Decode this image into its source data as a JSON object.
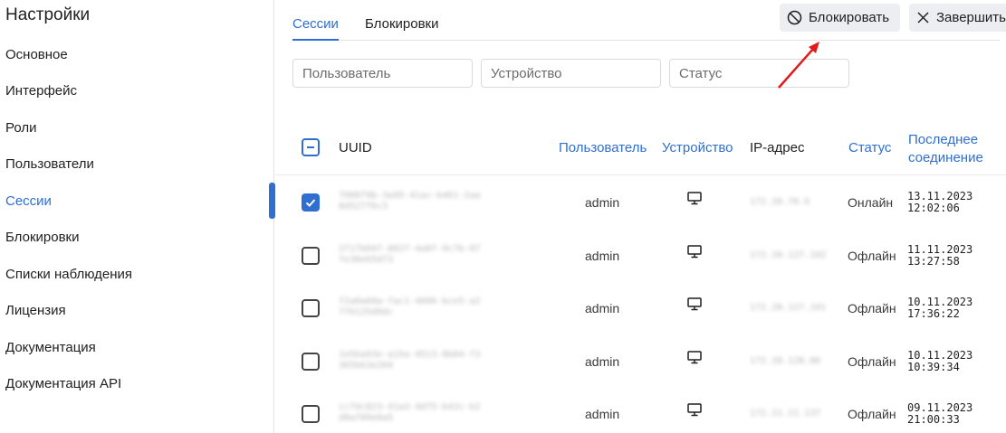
{
  "sidebar": {
    "title": "Настройки",
    "items": [
      {
        "label": "Основное"
      },
      {
        "label": "Интерфейс"
      },
      {
        "label": "Роли"
      },
      {
        "label": "Пользователи"
      },
      {
        "label": "Сессии"
      },
      {
        "label": "Блокировки"
      },
      {
        "label": "Списки наблюдения"
      },
      {
        "label": "Лицензия"
      },
      {
        "label": "Документация"
      },
      {
        "label": "Документация API"
      }
    ],
    "active_index": 4
  },
  "tabs": [
    {
      "label": "Сессии"
    },
    {
      "label": "Блокировки"
    }
  ],
  "toolbar": {
    "block_label": "Блокировать",
    "end_label": "Завершить"
  },
  "filters": {
    "user_placeholder": "Пользователь",
    "device_placeholder": "Устройство",
    "status_placeholder": "Статус"
  },
  "table": {
    "headers": {
      "uuid": "UUID",
      "user": "Пользователь",
      "device": "Устройство",
      "ip": "IP-адрес",
      "status": "Статус",
      "last_line1": "Последнее",
      "last_line2": "соединение"
    },
    "rows": [
      {
        "uuid": "7000f9b-3a95-41ac-b461-2aa8d527f6c3",
        "user": "admin",
        "device": "desktop",
        "ip": "172.20.70.6",
        "status": "Онлайн",
        "date": "13.11.2023",
        "time": "12:02:06",
        "checked": true
      },
      {
        "uuid": "2f17b047-802f-4a0f-9c7b-07fe38e65d73",
        "user": "admin",
        "device": "desktop",
        "ip": "172.20.127.102",
        "status": "Офлайн",
        "date": "11.11.2023",
        "time": "13:27:58",
        "checked": false
      },
      {
        "uuid": "f2a0a60a-fac1-4606-bce5-a27f6125d9dc",
        "user": "admin",
        "device": "desktop",
        "ip": "172.20.127.101",
        "status": "Офлайн",
        "date": "10.11.2023",
        "time": "17:36:22",
        "checked": false
      },
      {
        "uuid": "1e5ba93e-a15a-4513-8b04-f3365b63e204",
        "user": "admin",
        "device": "desktop",
        "ip": "172.20.128.86",
        "status": "Офлайн",
        "date": "10.11.2023",
        "time": "10:39:34",
        "checked": false
      },
      {
        "uuid": "cc7dc823-41a3-4df5-b43c-b2d8af09e0a5",
        "user": "admin",
        "device": "desktop",
        "ip": "172.21.21.137",
        "status": "Офлайн",
        "date": "09.11.2023",
        "time": "21:00:33",
        "checked": false
      }
    ]
  },
  "colors": {
    "accent": "#2f6fd0",
    "annotation_arrow": "#e01b1b"
  },
  "icons": {
    "block": "ban-icon",
    "end": "close-icon",
    "device": "monitor-icon"
  }
}
